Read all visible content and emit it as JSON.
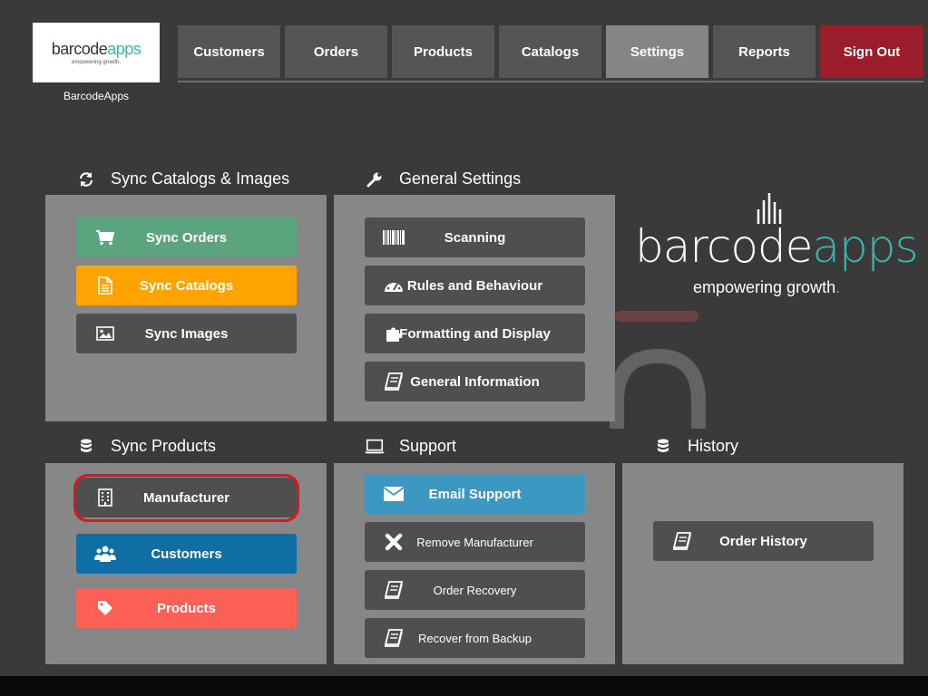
{
  "header": {
    "logo_word_a": "barcode",
    "logo_word_b": "apps",
    "logo_tagline": "empowering growth.",
    "logo_caption": "BarcodeApps",
    "nav": [
      {
        "label": "Customers"
      },
      {
        "label": "Orders"
      },
      {
        "label": "Products"
      },
      {
        "label": "Catalogs"
      },
      {
        "label": "Settings",
        "active": true
      },
      {
        "label": "Reports"
      },
      {
        "label": "Sign Out"
      }
    ]
  },
  "panels": {
    "sync_catalogs": {
      "title": "Sync Catalogs & Images",
      "icon": "refresh-icon",
      "buttons": [
        {
          "label": "Sync Orders",
          "icon": "cart-icon",
          "color": "#5aa57e"
        },
        {
          "label": "Sync Catalogs",
          "icon": "document-icon",
          "color": "#ffa300"
        },
        {
          "label": "Sync Images",
          "icon": "image-icon",
          "color": "#4f4f4f"
        }
      ]
    },
    "general_settings": {
      "title": "General Settings",
      "icon": "wrench-icon",
      "buttons": [
        {
          "label": "Scanning",
          "icon": "barcode-icon"
        },
        {
          "label": "Rules and Behaviour",
          "icon": "dashboard-icon"
        },
        {
          "label": "Formatting and Display",
          "icon": "puzzle-icon"
        },
        {
          "label": "General Information",
          "icon": "book-icon"
        }
      ]
    },
    "sync_products": {
      "title": "Sync Products",
      "icon": "database-icon",
      "buttons": [
        {
          "label": "Manufacturer",
          "icon": "building-icon",
          "color": "#4f4f4f"
        },
        {
          "label": "Customers",
          "icon": "users-icon",
          "color": "#0f6ea3"
        },
        {
          "label": "Products",
          "icon": "tag-icon",
          "color": "#fd6156"
        }
      ]
    },
    "support": {
      "title": "Support",
      "icon": "laptop-icon",
      "buttons": [
        {
          "label": "Email Support",
          "icon": "envelope-icon",
          "color": "#3c98c1"
        },
        {
          "label": "Remove Manufacturer",
          "icon": "x-icon"
        },
        {
          "label": "Order Recovery",
          "icon": "book-icon"
        },
        {
          "label": "Recover from Backup",
          "icon": "book-icon"
        }
      ]
    },
    "history": {
      "title": "History",
      "icon": "database-icon",
      "buttons": [
        {
          "label": "Order History",
          "icon": "book-icon"
        }
      ]
    }
  },
  "brand": {
    "word_a": "barcode",
    "word_b": "apps",
    "tagline": "empowering growth",
    "tagline_dot": ".",
    "accent_color": "#3bb5b0",
    "signout_color": "#9b1c2b"
  }
}
